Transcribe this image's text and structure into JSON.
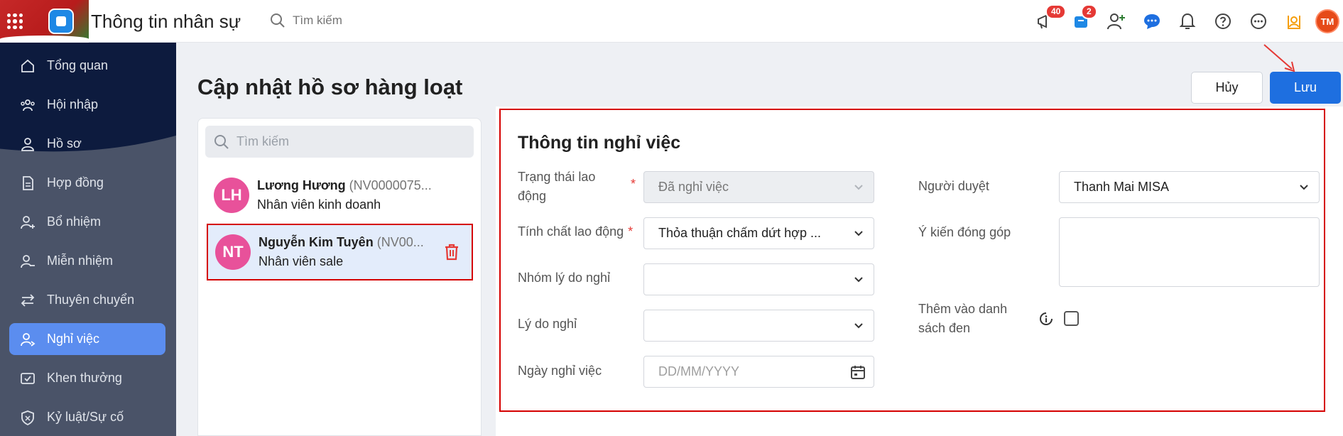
{
  "header": {
    "app_title": "Thông tin nhân sự",
    "search_placeholder": "Tìm kiếm",
    "badges": {
      "announcements": "40",
      "cart": "2"
    },
    "user_initials": "TM"
  },
  "sidebar": {
    "items": [
      {
        "label": "Tổng quan",
        "icon": "home-icon"
      },
      {
        "label": "Hội nhập",
        "icon": "team-icon"
      },
      {
        "label": "Hồ sơ",
        "icon": "user-icon"
      },
      {
        "label": "Hợp đồng",
        "icon": "document-icon"
      },
      {
        "label": "Bổ nhiệm",
        "icon": "user-plus-icon"
      },
      {
        "label": "Miễn nhiệm",
        "icon": "user-minus-icon"
      },
      {
        "label": "Thuyên chuyển",
        "icon": "transfer-icon"
      },
      {
        "label": "Nghỉ việc",
        "icon": "user-leave-icon",
        "active": true
      },
      {
        "label": "Khen thưởng",
        "icon": "reward-icon"
      },
      {
        "label": "Kỷ luật/Sự cố",
        "icon": "shield-icon"
      }
    ]
  },
  "page": {
    "title": "Cập nhật hồ sơ hàng loạt",
    "cancel_label": "Hủy",
    "save_label": "Lưu"
  },
  "employee_list": {
    "search_placeholder": "Tìm kiếm",
    "employees": [
      {
        "initials": "LH",
        "name": "Lương Hương",
        "code": "(NV0000075...",
        "role": "Nhân viên kinh doanh"
      },
      {
        "initials": "NT",
        "name": "Nguyễn Kim Tuyên",
        "code": "(NV00...",
        "role": "Nhân viên sale",
        "selected": true
      }
    ]
  },
  "form": {
    "title": "Thông tin nghỉ việc",
    "trang_thai_label": "Trạng thái lao động",
    "trang_thai_value": "Đã nghỉ việc",
    "tinh_chat_label": "Tính chất lao động",
    "tinh_chat_value": "Thỏa thuận chấm dứt hợp ...",
    "nhom_ly_do_label": "Nhóm lý do nghỉ",
    "nhom_ly_do_value": "",
    "ly_do_label": "Lý do nghỉ",
    "ly_do_value": "",
    "ngay_nghi_label": "Ngày nghỉ việc",
    "ngay_nghi_placeholder": "DD/MM/YYYY",
    "nguoi_duyet_label": "Người duyệt",
    "nguoi_duyet_value": "Thanh Mai MISA",
    "y_kien_label": "Ý kiến đóng góp",
    "y_kien_value": "",
    "blacklist_label": "Thêm vào danh sách đen",
    "blacklist_checked": false
  },
  "colors": {
    "primary": "#1e6fe0",
    "highlight_border": "#d50000",
    "sidebar_active": "#5b8def",
    "avatar_pink": "#e8519a"
  }
}
